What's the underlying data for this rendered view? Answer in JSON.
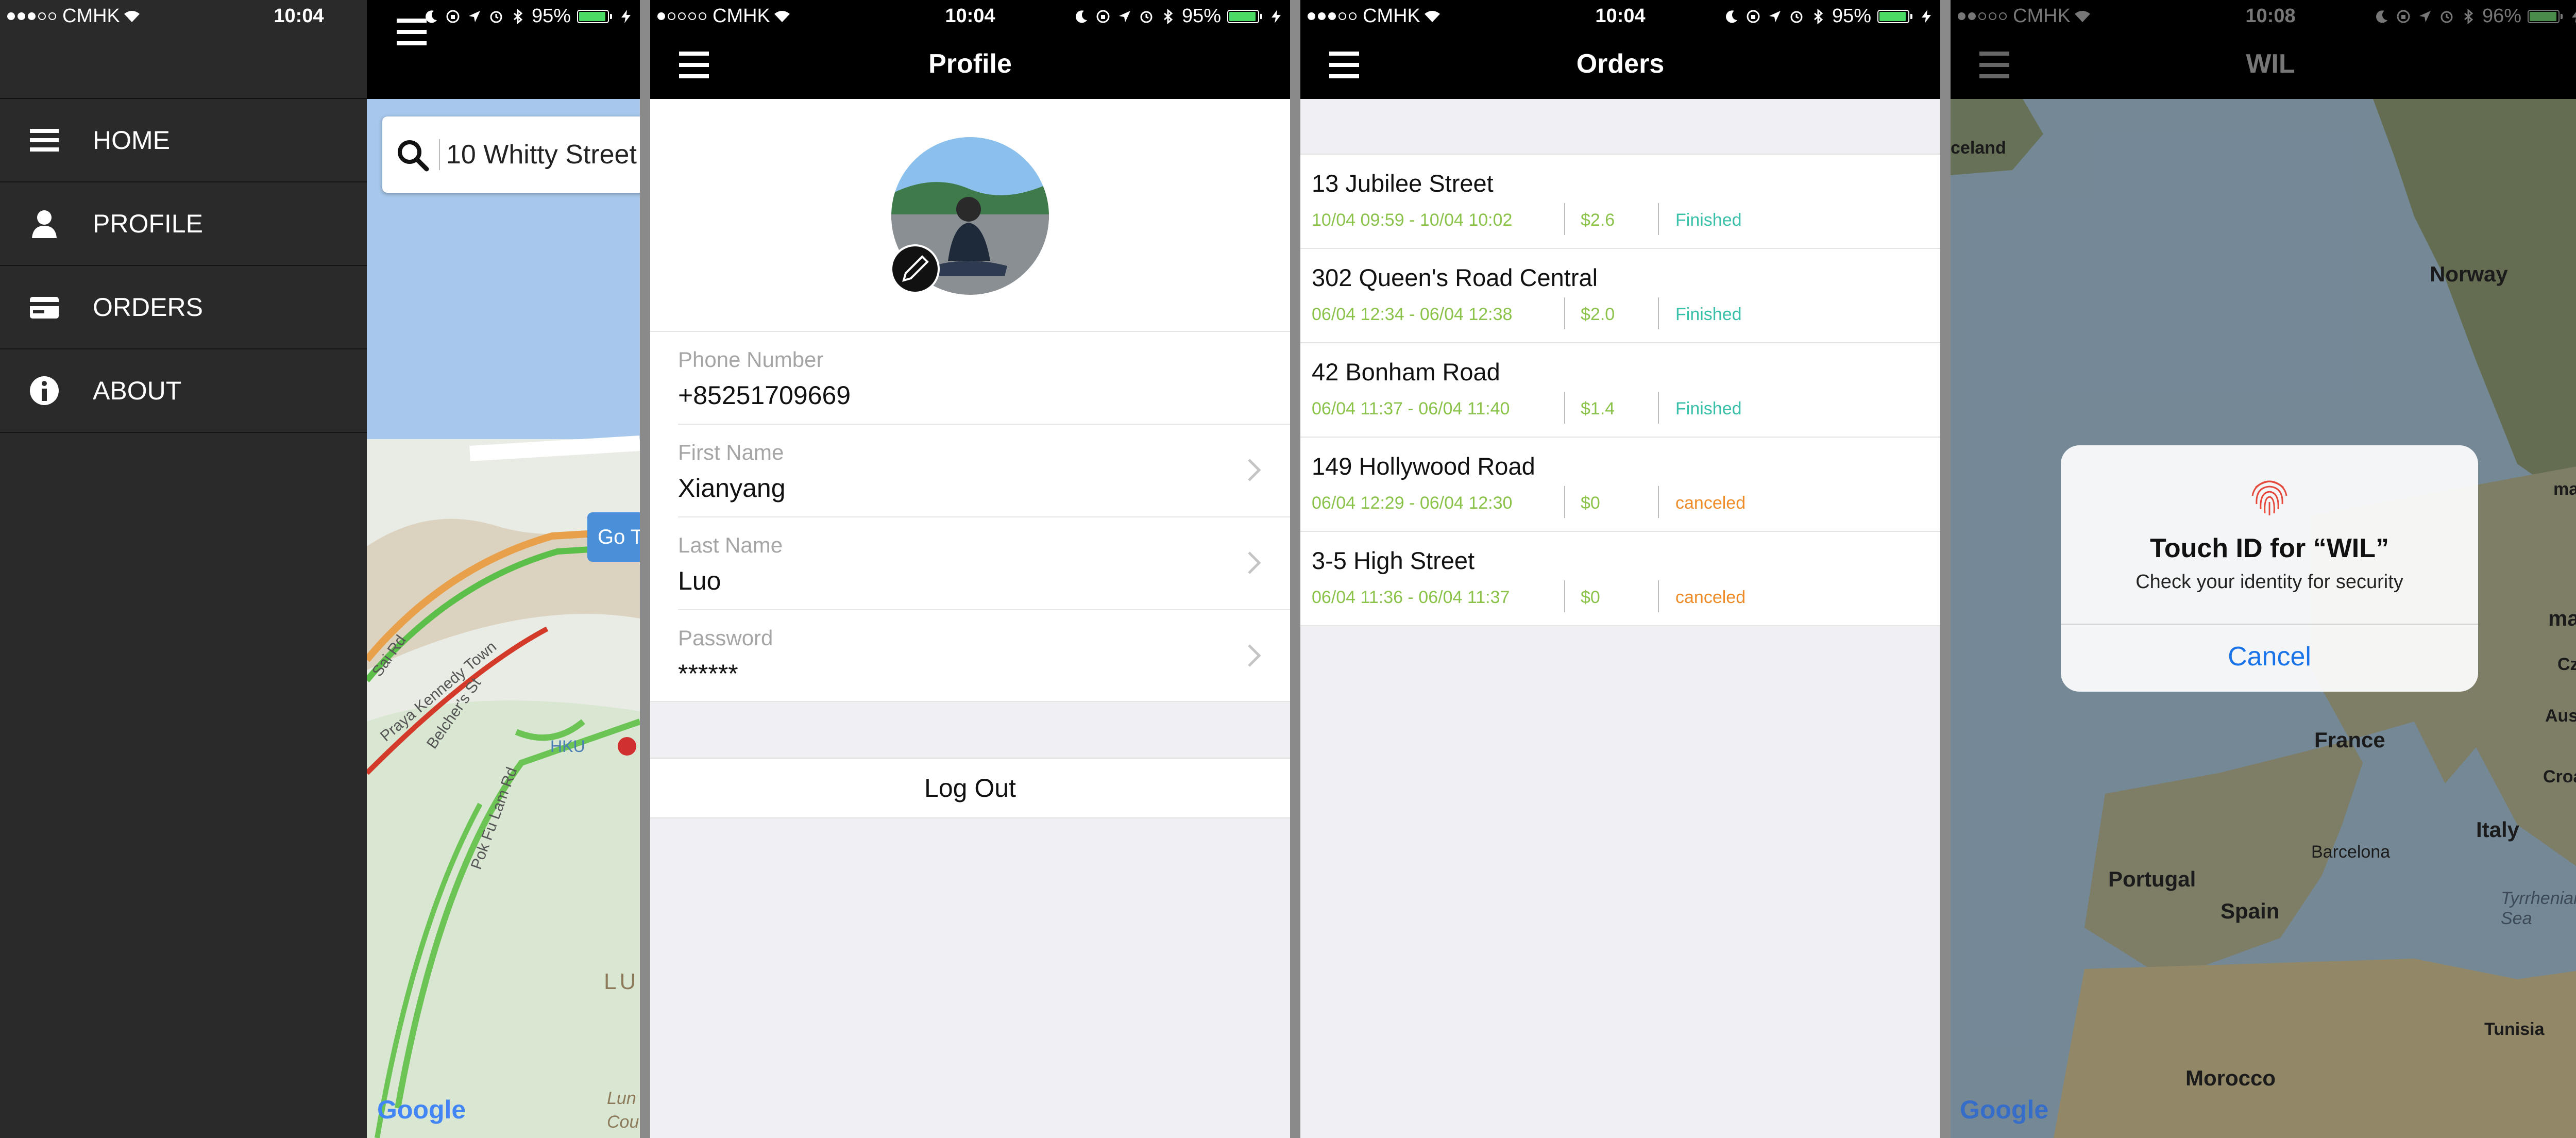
{
  "status_bars": [
    {
      "carrier": "CMHK",
      "time": "10:04",
      "battery": "95%"
    },
    {
      "carrier": "CMHK",
      "time": "10:04",
      "battery": "95%"
    },
    {
      "carrier": "CMHK",
      "time": "10:04",
      "battery": "95%"
    },
    {
      "carrier": "CMHK",
      "time": "10:08",
      "battery": "96%"
    }
  ],
  "drawer": {
    "items": [
      {
        "label": "HOME",
        "icon": "hamburger-icon"
      },
      {
        "label": "PROFILE",
        "icon": "person-icon"
      },
      {
        "label": "ORDERS",
        "icon": "card-icon"
      },
      {
        "label": "ABOUT",
        "icon": "info-icon"
      }
    ]
  },
  "home_map": {
    "search_value": "10 Whitty Street",
    "go_button": "Go T",
    "map_labels": [
      "HKU",
      "Pok Fu Lam Rd",
      "Praya Kennedy Town",
      "Belcher's St",
      "Sai Rd",
      "LU",
      "Lun",
      "Cou"
    ],
    "google": "Google"
  },
  "profile": {
    "title": "Profile",
    "fields": [
      {
        "label": "Phone Number",
        "value": "+85251709669"
      },
      {
        "label": "First Name",
        "value": "Xianyang"
      },
      {
        "label": "Last Name",
        "value": "Luo"
      },
      {
        "label": "Password",
        "value": "******"
      }
    ],
    "logout": "Log Out"
  },
  "orders": {
    "title": "Orders",
    "items": [
      {
        "address": "13 Jubilee Street",
        "time": "10/04 09:59 - 10/04 10:02",
        "price": "$2.6",
        "status": "Finished"
      },
      {
        "address": "302 Queen's Road Central",
        "time": "06/04 12:34 - 06/04 12:38",
        "price": "$2.0",
        "status": "Finished"
      },
      {
        "address": "42 Bonham Road",
        "time": "06/04 11:37 - 06/04 11:40",
        "price": "$1.4",
        "status": "Finished"
      },
      {
        "address": "149 Hollywood Road",
        "time": "06/04 12:29 - 06/04 12:30",
        "price": "$0",
        "status": "canceled"
      },
      {
        "address": "3-5 High Street",
        "time": "06/04 11:36 - 06/04 11:37",
        "price": "$0",
        "status": "canceled"
      }
    ],
    "colors": {
      "finished": "#39c0a8",
      "canceled": "#f08c28",
      "meta": "#8bc34a"
    }
  },
  "touchid": {
    "app_title": "WIL",
    "dialog_title": "Touch ID for “WIL”",
    "dialog_subtitle": "Check your identity for security",
    "cancel": "Cancel",
    "map_labels": [
      "celand",
      "Norway",
      "mark",
      "many",
      "Czech",
      "Austria",
      "Croatia",
      "France",
      "Italy",
      "Barcelona",
      "Portugal",
      "Spain",
      "Tyrrhenian Sea",
      "Tunisia",
      "Morocco"
    ],
    "google": "Google"
  }
}
